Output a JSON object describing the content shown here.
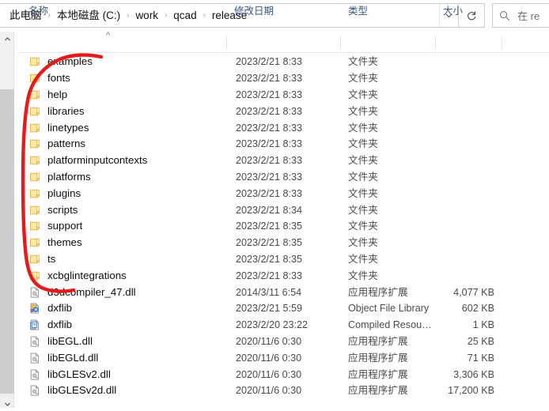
{
  "window": {
    "app": "Windows File Explorer",
    "accent_color": "#3b5a80",
    "annotation_color": "#e8191b"
  },
  "addressbar": {
    "crumbs": [
      {
        "label": "此电脑"
      },
      {
        "label": "本地磁盘 (C:)"
      },
      {
        "label": "work"
      },
      {
        "label": "qcad"
      },
      {
        "label": "release"
      }
    ],
    "separator": "›",
    "dropdown_icon": "chevron-down-icon",
    "refresh_icon": "refresh-icon",
    "refresh_glyph": "↻"
  },
  "search": {
    "icon": "search-icon",
    "placeholder": "在 re"
  },
  "columns": {
    "sort_indicator": "^",
    "headers": [
      {
        "key": "name",
        "label": "名称"
      },
      {
        "key": "date",
        "label": "修改日期"
      },
      {
        "key": "type",
        "label": "类型"
      },
      {
        "key": "size",
        "label": "大小"
      }
    ]
  },
  "files": [
    {
      "name": "examples",
      "date": "2023/2/21 8:33",
      "type": "文件夹",
      "size": "",
      "icon": "folder-icon"
    },
    {
      "name": "fonts",
      "date": "2023/2/21 8:33",
      "type": "文件夹",
      "size": "",
      "icon": "folder-icon"
    },
    {
      "name": "help",
      "date": "2023/2/21 8:33",
      "type": "文件夹",
      "size": "",
      "icon": "folder-icon"
    },
    {
      "name": "libraries",
      "date": "2023/2/21 8:33",
      "type": "文件夹",
      "size": "",
      "icon": "folder-icon"
    },
    {
      "name": "linetypes",
      "date": "2023/2/21 8:33",
      "type": "文件夹",
      "size": "",
      "icon": "folder-icon"
    },
    {
      "name": "patterns",
      "date": "2023/2/21 8:33",
      "type": "文件夹",
      "size": "",
      "icon": "folder-icon"
    },
    {
      "name": "platforminputcontexts",
      "date": "2023/2/21 8:33",
      "type": "文件夹",
      "size": "",
      "icon": "folder-icon"
    },
    {
      "name": "platforms",
      "date": "2023/2/21 8:33",
      "type": "文件夹",
      "size": "",
      "icon": "folder-icon"
    },
    {
      "name": "plugins",
      "date": "2023/2/21 8:33",
      "type": "文件夹",
      "size": "",
      "icon": "folder-icon"
    },
    {
      "name": "scripts",
      "date": "2023/2/21 8:34",
      "type": "文件夹",
      "size": "",
      "icon": "folder-icon"
    },
    {
      "name": "support",
      "date": "2023/2/21 8:35",
      "type": "文件夹",
      "size": "",
      "icon": "folder-icon"
    },
    {
      "name": "themes",
      "date": "2023/2/21 8:35",
      "type": "文件夹",
      "size": "",
      "icon": "folder-icon"
    },
    {
      "name": "ts",
      "date": "2023/2/21 8:35",
      "type": "文件夹",
      "size": "",
      "icon": "folder-icon"
    },
    {
      "name": "xcbglintegrations",
      "date": "2023/2/21 8:33",
      "type": "文件夹",
      "size": "",
      "icon": "folder-icon"
    },
    {
      "name": "d3dcompiler_47.dll",
      "date": "2014/3/11 6:54",
      "type": "应用程序扩展",
      "size": "4,077 KB",
      "icon": "dll-file-icon"
    },
    {
      "name": "dxflib",
      "date": "2023/2/21 5:59",
      "type": "Object File Library",
      "size": "602 KB",
      "icon": "object-library-icon"
    },
    {
      "name": "dxflib",
      "date": "2023/2/20 23:22",
      "type": "Compiled Resou…",
      "size": "1 KB",
      "icon": "compiled-resource-icon"
    },
    {
      "name": "libEGL.dll",
      "date": "2020/11/6 0:30",
      "type": "应用程序扩展",
      "size": "25 KB",
      "icon": "dll-file-icon"
    },
    {
      "name": "libEGLd.dll",
      "date": "2020/11/6 0:30",
      "type": "应用程序扩展",
      "size": "71 KB",
      "icon": "dll-file-icon"
    },
    {
      "name": "libGLESv2.dll",
      "date": "2020/11/6 0:30",
      "type": "应用程序扩展",
      "size": "3,306 KB",
      "icon": "dll-file-icon"
    },
    {
      "name": "libGLESv2d.dll",
      "date": "2020/11/6 0:30",
      "type": "应用程序扩展",
      "size": "17,200 KB",
      "icon": "dll-file-icon"
    }
  ],
  "scrollbar": {
    "up_glyph": "⌃",
    "down_glyph": "⌄"
  }
}
